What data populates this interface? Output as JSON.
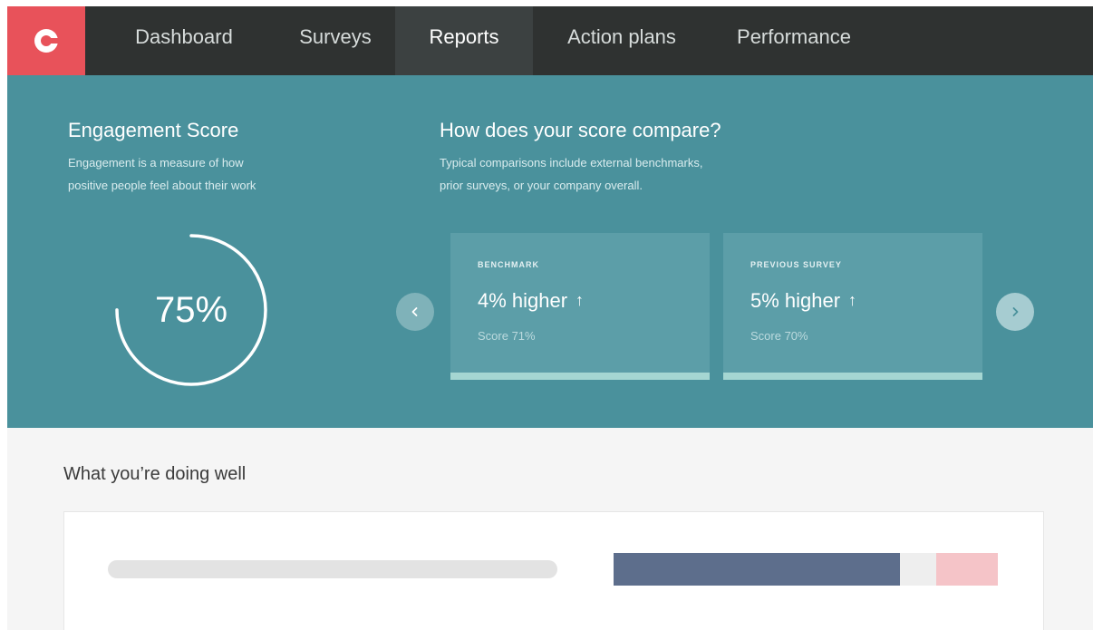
{
  "nav": {
    "logo_letter": "C",
    "items": [
      {
        "label": "Dashboard",
        "active": false
      },
      {
        "label": "Surveys",
        "active": false
      },
      {
        "label": "Reports",
        "active": true
      },
      {
        "label": "Action plans",
        "active": false
      },
      {
        "label": "Performance",
        "active": false
      }
    ]
  },
  "engagement": {
    "title": "Engagement Score",
    "desc_line1": "Engagement is a measure of how",
    "desc_line2": "positive people feel about their work",
    "score_text": "75%",
    "score_fraction": 0.75
  },
  "compare": {
    "title": "How does your score compare?",
    "desc_line1": "Typical comparisons include external benchmarks,",
    "desc_line2": "prior surveys, or your company overall.",
    "prev_icon": "chevron-left-icon",
    "next_icon": "chevron-right-icon",
    "cards": [
      {
        "label": "BENCHMARK",
        "value": "4% higher",
        "arrow": "↑",
        "score": "Score 71%"
      },
      {
        "label": "PREVIOUS SURVEY",
        "value": "5% higher",
        "arrow": "↑",
        "score": "Score 70%"
      }
    ]
  },
  "doing_well": {
    "title": "What you’re doing well",
    "bar_segments": [
      {
        "fraction": 0.745,
        "color": "#5d6e8c"
      },
      {
        "fraction": 0.095,
        "color": "#eeeeee"
      },
      {
        "fraction": 0.16,
        "color": "#f5c4c8"
      }
    ]
  },
  "colors": {
    "brand": "#e8525a",
    "nav_bg": "#2f3231",
    "hero_bg": "#4a919c",
    "card_bg": "#5c9ea8",
    "card_accent": "#a5d6d2"
  }
}
